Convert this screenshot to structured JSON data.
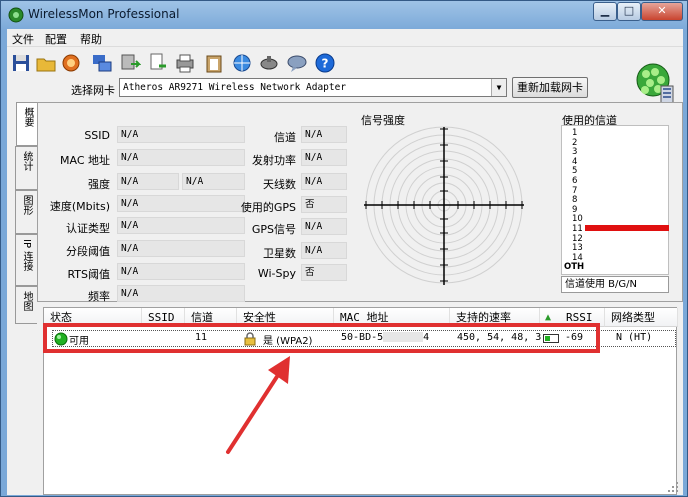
{
  "window": {
    "title": "WirelessMon Professional"
  },
  "menu": [
    "文件",
    "配置",
    "帮助"
  ],
  "toolbar": {
    "adapter_label": "选择网卡",
    "adapter_value": "Atheros AR9271 Wireless Network Adapter",
    "reload_label": "重新加载网卡"
  },
  "tabs": [
    "概要",
    "统计",
    "图形",
    "IP 连接",
    "地图"
  ],
  "fields": {
    "ssid_label": "SSID",
    "ssid_value": "N/A",
    "mac_label": "MAC 地址",
    "mac_value": "N/A",
    "strength_label": "强度",
    "strength_value1": "N/A",
    "strength_value2": "N/A",
    "speed_label": "速度(Mbits)",
    "speed_value": "N/A",
    "auth_label": "认证类型",
    "auth_value": "N/A",
    "frag_label": "分段阈值",
    "frag_value": "N/A",
    "rts_label": "RTS阈值",
    "rts_value": "N/A",
    "freq_label": "频率",
    "freq_value": "N/A",
    "channel_label": "信道",
    "channel_value": "N/A",
    "txpower_label": "发射功率",
    "txpower_value": "N/A",
    "antenna_label": "天线数",
    "antenna_value": "N/A",
    "gps_used_label": "使用的GPS",
    "gps_used_value": "否",
    "gps_signal_label": "GPS信号",
    "gps_signal_value": "N/A",
    "satellite_label": "卫星数",
    "satellite_value": "N/A",
    "wispy_label": "Wi-Spy",
    "wispy_value": "否"
  },
  "signal": {
    "title": "信号强度"
  },
  "channels": {
    "title": "使用的信道",
    "numbers": [
      "1",
      "2",
      "3",
      "4",
      "5",
      "6",
      "7",
      "8",
      "9",
      "10",
      "11",
      "12",
      "13",
      "14",
      "OTH"
    ],
    "used_channel": 11,
    "footer": "信道使用 B/G/N"
  },
  "list": {
    "headers": [
      "状态",
      "SSID",
      "信道",
      "安全性",
      "MAC 地址",
      "支持的速率",
      "RSSI",
      "网络类型"
    ],
    "rows": [
      {
        "status": "可用",
        "ssid": "",
        "channel": "11",
        "security": "是 (WPA2)",
        "mac": "50-BD-5",
        "mac_tail": "4",
        "rates": "450, 54, 48, 3...",
        "rssi": "-69",
        "type": "N (HT)"
      }
    ]
  },
  "colors": {
    "highlight": "#e03030",
    "used_channel_bar": "#e01010",
    "status_ok": "#22b022"
  }
}
